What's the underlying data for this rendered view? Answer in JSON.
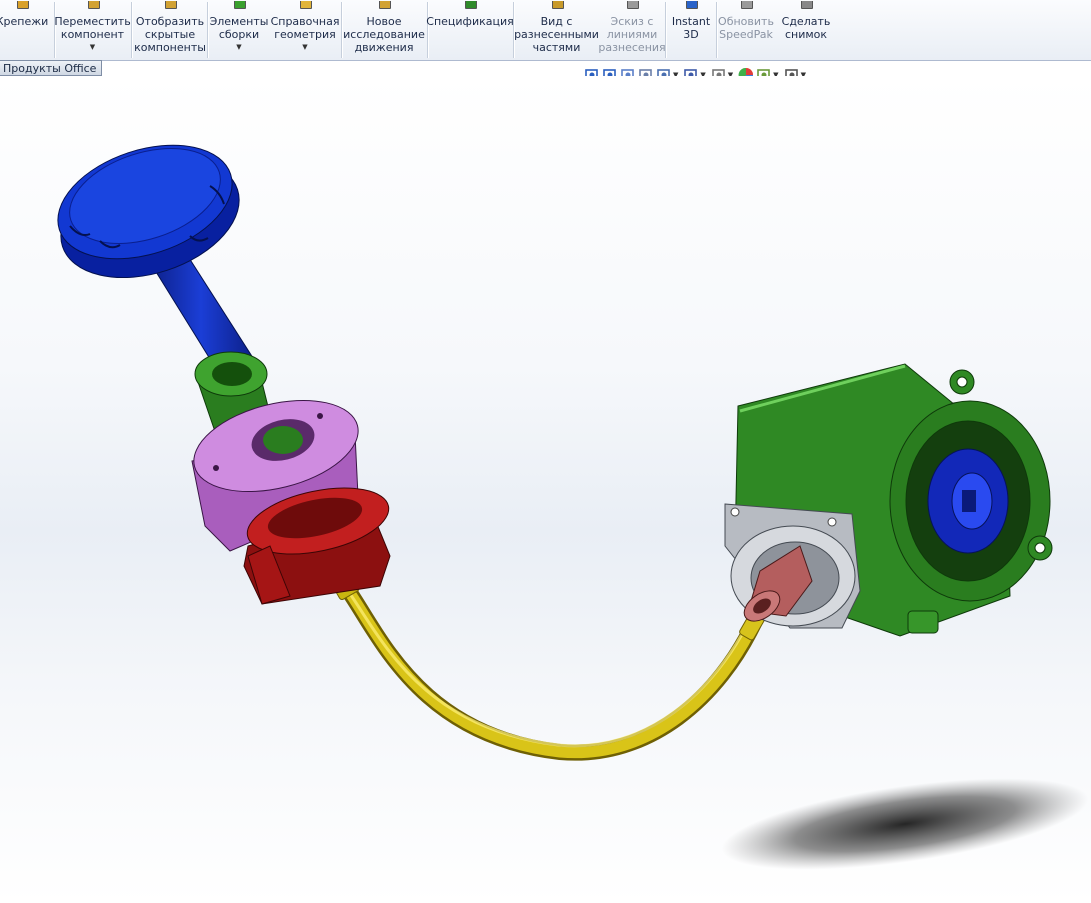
{
  "ribbon": {
    "tools": [
      {
        "id": "fasteners",
        "label": "Крепежи",
        "has_menu": false,
        "enabled": true,
        "icon": "fastener-icon"
      },
      {
        "id": "move",
        "label": "Переместить\nкомпонент",
        "has_menu": true,
        "enabled": true,
        "icon": "move-component-icon"
      },
      {
        "id": "show_hidden",
        "label": "Отобразить\nскрытые\nкомпоненты",
        "has_menu": false,
        "enabled": true,
        "icon": "show-hidden-icon"
      },
      {
        "id": "assembly_features",
        "label": "Элементы\nсборки",
        "has_menu": true,
        "enabled": true,
        "icon": "assembly-features-icon"
      },
      {
        "id": "reference_geometry",
        "label": "Справочная\nгеометрия",
        "has_menu": true,
        "enabled": true,
        "icon": "reference-geometry-icon"
      },
      {
        "id": "motion_study",
        "label": "Новое\nисследование\nдвижения",
        "has_menu": false,
        "enabled": true,
        "icon": "motion-study-icon"
      },
      {
        "id": "bom",
        "label": "Спецификация",
        "has_menu": false,
        "enabled": true,
        "icon": "bom-icon"
      },
      {
        "id": "exploded_view",
        "label": "Вид с\nразнесенными\nчастями",
        "has_menu": false,
        "enabled": true,
        "icon": "exploded-view-icon"
      },
      {
        "id": "explode_line",
        "label": "Эскиз с\nлиниями\nразнесения",
        "has_menu": false,
        "enabled": false,
        "icon": "explode-line-icon"
      },
      {
        "id": "instant3d",
        "label": "Instant\n3D",
        "has_menu": false,
        "enabled": true,
        "icon": "instant3d-icon"
      },
      {
        "id": "speedpak",
        "label": "Обновить\nSpeedPak",
        "has_menu": false,
        "enabled": false,
        "icon": "speedpak-icon"
      },
      {
        "id": "snapshot",
        "label": "Сделать\nснимок",
        "has_menu": false,
        "enabled": true,
        "icon": "snapshot-icon"
      }
    ]
  },
  "office_tab": {
    "label": "Продукты Office"
  },
  "view_toolbar": {
    "buttons": [
      {
        "icon": "zoom-to-fit-icon",
        "has_menu": false
      },
      {
        "icon": "zoom-to-area-icon",
        "has_menu": false
      },
      {
        "icon": "previous-view-icon",
        "has_menu": false
      },
      {
        "icon": "section-view-icon",
        "has_menu": false
      },
      {
        "icon": "view-orientation-icon",
        "has_menu": true
      },
      {
        "icon": "display-style-icon",
        "has_menu": true
      },
      {
        "icon": "hide-show-items-icon",
        "has_menu": true
      },
      {
        "icon": "edit-appearance-icon",
        "has_menu": false
      },
      {
        "icon": "apply-scene-icon",
        "has_menu": true
      },
      {
        "icon": "view-settings-icon",
        "has_menu": true
      }
    ]
  },
  "model": {
    "colors": {
      "knob": "#0a2db8",
      "shaft": "#0a22a8",
      "sleeve_green": "#2e8a22",
      "ring_violet": "#c47ad8",
      "nut_red": "#b01818",
      "cable_yellow": "#e8d21a",
      "housing_green": "#3aa02e",
      "fitting_pink": "#c56b6b",
      "flange_gray": "#c9ccd2",
      "drive_blue": "#1430d0"
    }
  }
}
